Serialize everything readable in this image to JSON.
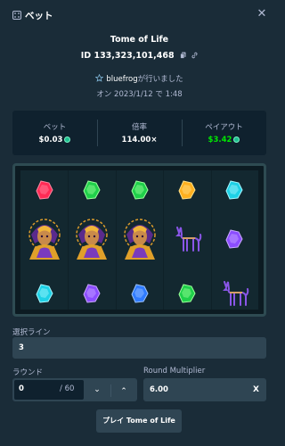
{
  "header": {
    "title": "ベット",
    "icon": "dice-icon",
    "close_icon": "close-icon",
    "close_glyph": "✕"
  },
  "game": {
    "title": "Tome of Life",
    "bet_id": "ID 133,323,101,468",
    "player_name": "bluefrog",
    "player_suffix": "が行いました",
    "date_prefix": "オン",
    "date": "2023/1/12",
    "date_mid": "で",
    "time": "1:48"
  },
  "stats": [
    {
      "label": "ベット",
      "value": "$0.03",
      "coin": true,
      "color": "#ffffff"
    },
    {
      "label": "倍率",
      "value": "114.00×",
      "coin": false,
      "color": "#ffffff"
    },
    {
      "label": "ペイアウト",
      "value": "$3.42",
      "coin": true,
      "color": "#00e701"
    }
  ],
  "reels": {
    "columns": [
      [
        "red-gem",
        "sorceress",
        "cyan-gem"
      ],
      [
        "green-gem",
        "sorceress",
        "purple-gem"
      ],
      [
        "green-gem",
        "sorceress",
        "blue-gem"
      ],
      [
        "orange-gem",
        "jackal",
        "green-gem"
      ],
      [
        "cyan-gem",
        "purple-gem",
        "jackal"
      ]
    ]
  },
  "lines": {
    "label": "選択ライン",
    "value": "3"
  },
  "rounds": {
    "label": "ラウンド",
    "value": "0",
    "suffix": "/ 60",
    "down_glyph": "⌄",
    "up_glyph": "⌃"
  },
  "multiplier": {
    "label": "Round Multiplier",
    "value": "6.00",
    "clear_glyph": "X"
  },
  "play_button": {
    "label": "プレイ Tome of Life"
  },
  "colors": {
    "background": "#1a2c38",
    "panel": "#0f212e",
    "input_border": "#2f4553",
    "payout": "#00e701"
  }
}
